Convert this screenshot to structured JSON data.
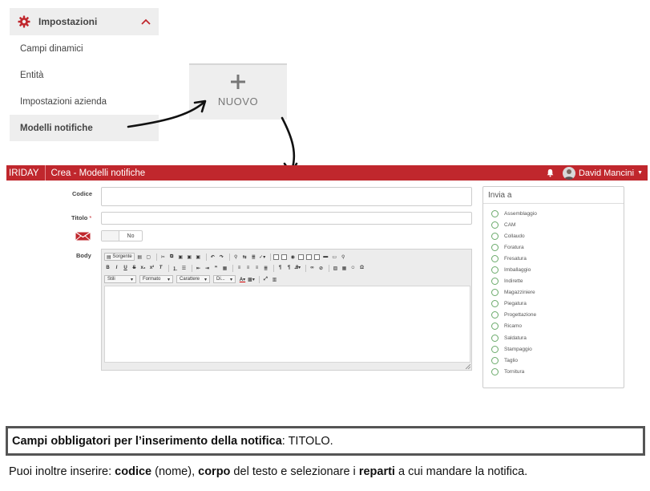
{
  "menu": {
    "title": "Impostazioni",
    "items": [
      {
        "label": "Campi dinamici"
      },
      {
        "label": "Entità"
      },
      {
        "label": "Impostazioni azienda"
      },
      {
        "label": "Modelli notifiche"
      }
    ],
    "active_index": 3
  },
  "nuovo": {
    "label": "NUOVO"
  },
  "appbar": {
    "brand": "IRIDAY",
    "title": "Crea - Modelli notifiche",
    "user": "David Mancini",
    "color": "#c0272d"
  },
  "form": {
    "codice_label": "Codice",
    "titolo_label": "Titolo",
    "titolo_required_mark": "*",
    "toggle_value": "No",
    "body_label": "Body"
  },
  "editor": {
    "source_button": "Sorgente",
    "combos": [
      {
        "label": "Stili"
      },
      {
        "label": "Formato"
      },
      {
        "label": "Carattere"
      },
      {
        "label": "Di..."
      }
    ]
  },
  "invia": {
    "title": "Invia a",
    "departments": [
      "Assemblaggio",
      "CAM",
      "Collaudo",
      "Foratura",
      "Fresatura",
      "Imballaggio",
      "Indirette",
      "Magazziniere",
      "Piegatura",
      "Progettazione",
      "Ricamo",
      "Saldatura",
      "Stampaggio",
      "Taglio",
      "Tornitura"
    ]
  },
  "notes": {
    "box_bold": "Campi obbligatori per l’inserimento della notifica",
    "box_rest": ": TITOLO.",
    "line_parts": [
      {
        "text": "Puoi inoltre inserire: ",
        "bold": false
      },
      {
        "text": "codice",
        "bold": true
      },
      {
        "text": " (nome), ",
        "bold": false
      },
      {
        "text": "corpo",
        "bold": true
      },
      {
        "text": " del testo e selezionare i ",
        "bold": false
      },
      {
        "text": "reparti",
        "bold": true
      },
      {
        "text": " a cui mandare la notifica.",
        "bold": false
      }
    ]
  }
}
